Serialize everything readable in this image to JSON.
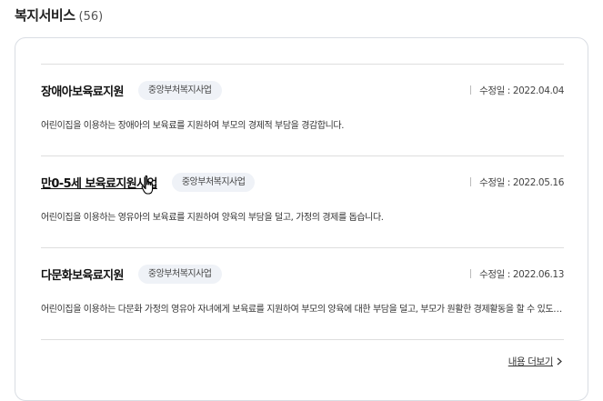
{
  "header": {
    "title": "복지서비스",
    "count": "(56)"
  },
  "items": [
    {
      "title": "장애아보육료지원",
      "badge": "중앙부처복지사업",
      "date_label": "수정일 : 2022.04.04",
      "description": "어린이집을 이용하는 장애아의 보육료를 지원하여 부모의 경제적 부담을 경감합니다."
    },
    {
      "title": "만0-5세 보육료지원사업",
      "badge": "중앙부처복지사업",
      "date_label": "수정일 : 2022.05.16",
      "description": "어린이집을 이용하는 영유아의 보육료를 지원하여 양육의 부담을 덜고, 가정의 경제를 돕습니다."
    },
    {
      "title": "다문화보육료지원",
      "badge": "중앙부처복지사업",
      "date_label": "수정일 : 2022.06.13",
      "description": "어린이집을 이용하는 다문화 가정의 영유아 자녀에게 보육료를 지원하여 부모의 양육에 대한 부담을 덜고, 부모가 원활한 경제활동을 할 수 있도록 지원합니다."
    }
  ],
  "more_link": {
    "label": "내용 더보기",
    "icon": "chevron-right-icon"
  },
  "cursor": {
    "icon": "hand-pointer-icon"
  }
}
